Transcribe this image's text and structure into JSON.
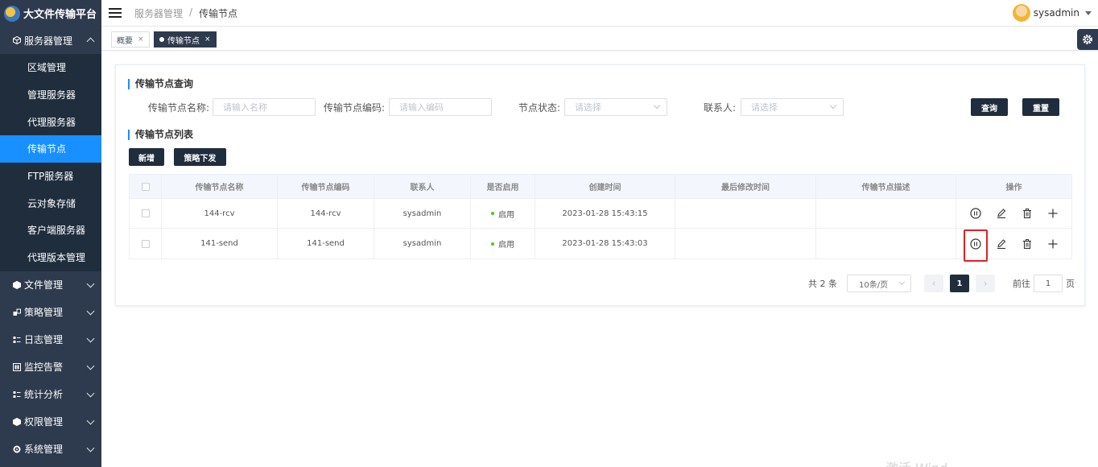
{
  "app": {
    "title": "大文件传输平台"
  },
  "sidebar": {
    "groups": [
      {
        "label": "服务器管理",
        "icon": "cube-icon"
      },
      {
        "label": "文件管理",
        "icon": "cube-icon"
      },
      {
        "label": "策略管理",
        "icon": "cubes-icon"
      },
      {
        "label": "日志管理",
        "icon": "log-icon"
      },
      {
        "label": "监控告警",
        "icon": "monitor-icon"
      },
      {
        "label": "统计分析",
        "icon": "chart-icon"
      },
      {
        "label": "权限管理",
        "icon": "cube-icon"
      },
      {
        "label": "系统管理",
        "icon": "gear-icon"
      }
    ],
    "items": [
      {
        "label": "区域管理"
      },
      {
        "label": "管理服务器"
      },
      {
        "label": "代理服务器"
      },
      {
        "label": "传输节点"
      },
      {
        "label": "FTP服务器"
      },
      {
        "label": "云对象存储"
      },
      {
        "label": "客户端服务器"
      },
      {
        "label": "代理版本管理"
      }
    ]
  },
  "header": {
    "breadcrumb": [
      "服务器管理",
      "/",
      "传输节点"
    ],
    "username": "sysadmin"
  },
  "tags": [
    {
      "label": "概要",
      "close": "×"
    },
    {
      "label": "传输节点",
      "close": "×"
    }
  ],
  "query": {
    "title": "传输节点查询",
    "name_label": "传输节点名称:",
    "name_placeholder": "请输入名称",
    "code_label": "传输节点编码:",
    "code_placeholder": "请输入编码",
    "status_label": "节点状态:",
    "status_placeholder": "请选择",
    "contact_label": "联系人:",
    "contact_placeholder": "请选择",
    "search_button": "查询",
    "reset_button": "重置"
  },
  "list": {
    "title": "传输节点列表",
    "add_button": "新增",
    "policy_button": "策略下发",
    "columns": [
      "传输节点名称",
      "传输节点编码",
      "联系人",
      "是否启用",
      "创建时间",
      "最后修改时间",
      "传输节点描述",
      "操作"
    ],
    "rows": [
      {
        "name": "144-rcv",
        "code": "144-rcv",
        "contact": "sysadmin",
        "status": "启用",
        "created": "2023-01-28 15:43:15",
        "modified": "",
        "desc": ""
      },
      {
        "name": "141-send",
        "code": "141-send",
        "contact": "sysadmin",
        "status": "启用",
        "created": "2023-01-28 15:43:03",
        "modified": "",
        "desc": ""
      }
    ],
    "status_color": "#52c41a"
  },
  "pagination": {
    "total_text": "共 2 条",
    "page_size": "10条/页",
    "prev": "‹",
    "current_page": "1",
    "next": "›",
    "goto_label": "前往",
    "goto_value": "1",
    "goto_suffix": "页"
  },
  "watermark": "激活 Wind",
  "colors": {
    "sidebar_bg": "#2e3a4d",
    "active_item": "#1890ff",
    "dark_button": "#1f2d3d",
    "highlight": "#e02020"
  }
}
